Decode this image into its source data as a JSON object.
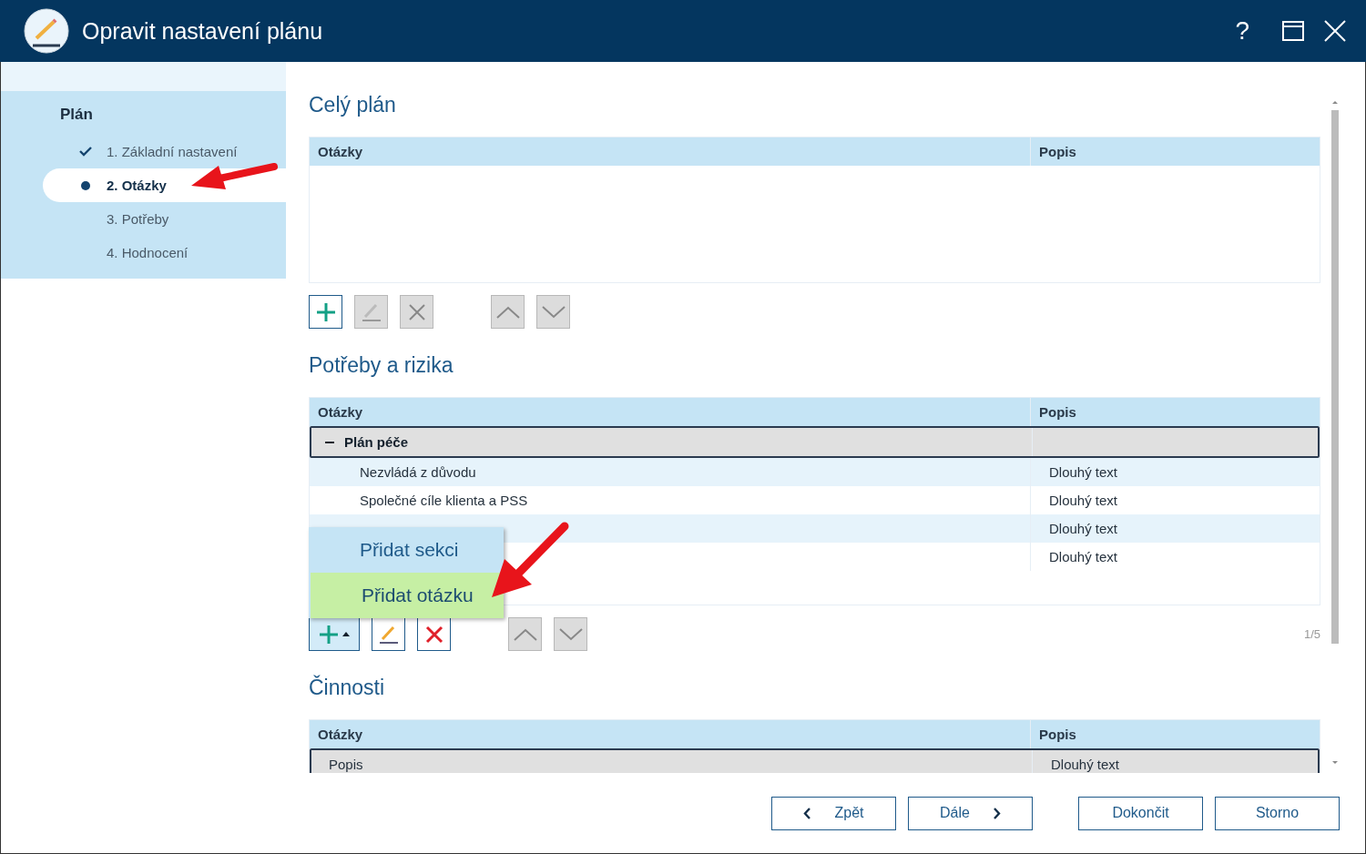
{
  "window": {
    "title": "Opravit nastavení plánu",
    "help": "?"
  },
  "sidebar": {
    "title": "Plán",
    "steps": [
      {
        "label": "1. Základní nastavení",
        "kind": "done",
        "selected": false
      },
      {
        "label": "2. Otázky",
        "kind": "current",
        "selected": true
      },
      {
        "label": "3. Potřeby",
        "kind": "pending",
        "selected": false
      },
      {
        "label": "4. Hodnocení",
        "kind": "pending",
        "selected": false
      }
    ]
  },
  "sections": [
    {
      "title": "Celý plán",
      "columns": [
        "Otázky",
        "Popis"
      ],
      "toolbar": [
        {
          "kind": "add",
          "disabled": false
        },
        {
          "kind": "edit",
          "disabled": true
        },
        {
          "kind": "delete",
          "disabled": true
        },
        {
          "kind": "up",
          "disabled": true
        },
        {
          "kind": "down",
          "disabled": true
        }
      ]
    },
    {
      "title": "Potřeby a rizika",
      "columns": [
        "Otázky",
        "Popis"
      ],
      "rows": [
        {
          "kind": "group",
          "label": "Plán péče",
          "expanded": true,
          "selected": true,
          "children": [
            {
              "kind": "item",
              "question": "Nezvládá z důvodu",
              "description": "Dlouhý text",
              "selected": false
            },
            {
              "kind": "item",
              "question": "Společné cíle klienta a PSS",
              "description": "Dlouhý text",
              "selected": false
            },
            {
              "kind": "item",
              "description": "Dlouhý text",
              "selected": false
            },
            {
              "kind": "item",
              "description": "Dlouhý text",
              "selected": false
            }
          ]
        }
      ],
      "toolbar": [
        {
          "kind": "add-menu",
          "disabled": false,
          "expanded": true
        },
        {
          "kind": "edit",
          "disabled": false
        },
        {
          "kind": "delete",
          "disabled": false
        },
        {
          "kind": "up",
          "disabled": true
        },
        {
          "kind": "down",
          "disabled": true
        }
      ],
      "menu": [
        {
          "label": "Přidat sekci",
          "selected": false
        },
        {
          "label": "Přidat otázku",
          "selected": true
        }
      ],
      "pager": "1/5"
    },
    {
      "title": "Činnosti",
      "columns": [
        "Otázky",
        "Popis"
      ],
      "rows": [
        {
          "kind": "item",
          "question": "Popis",
          "description": "Dlouhý text",
          "selected": true
        }
      ]
    }
  ],
  "footer": [
    {
      "label": "Zpět",
      "kind": "back"
    },
    {
      "label": "Dále",
      "kind": "next"
    },
    {
      "label": "Dokončit",
      "kind": "plain"
    },
    {
      "label": "Storno",
      "kind": "plain"
    }
  ]
}
